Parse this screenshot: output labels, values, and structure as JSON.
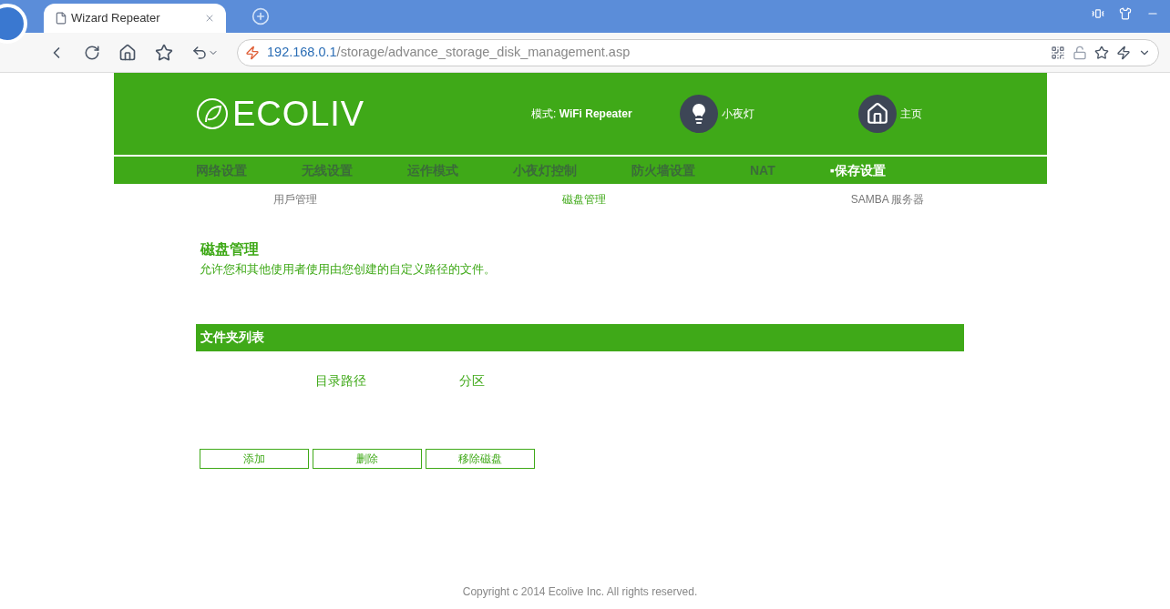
{
  "browser": {
    "tab_title": "Wizard Repeater",
    "url_host": "192.168.0.1",
    "url_path": "/storage/advance_storage_disk_management.asp"
  },
  "header": {
    "logo": "ECOLIV",
    "mode_label": "模式: ",
    "mode_value": "WiFi Repeater",
    "night_light": "小夜灯",
    "home": "主页"
  },
  "nav": [
    {
      "label": "网络设置",
      "selected": false
    },
    {
      "label": "无线设置",
      "selected": false
    },
    {
      "label": "运作模式",
      "selected": false
    },
    {
      "label": "小夜灯控制",
      "selected": false
    },
    {
      "label": "防火墙设置",
      "selected": false
    },
    {
      "label": "NAT",
      "selected": false
    },
    {
      "label": "保存设置",
      "selected": true
    }
  ],
  "nav_bullet": "▪",
  "subnav": [
    {
      "label": "用戶管理",
      "selected": false
    },
    {
      "label": "磁盘管理",
      "selected": true
    },
    {
      "label": "SAMBA 服务器",
      "selected": false
    }
  ],
  "page": {
    "title": "磁盘管理",
    "description": "允许您和其他使用者使用由您创建的自定义路径的文件。"
  },
  "table": {
    "title": "文件夹列表",
    "columns": [
      "目录路径",
      "分区"
    ]
  },
  "buttons": [
    "添加",
    "删除",
    "移除磁盘"
  ],
  "footer": "Copyright c 2014 Ecolive Inc. All rights reserved."
}
